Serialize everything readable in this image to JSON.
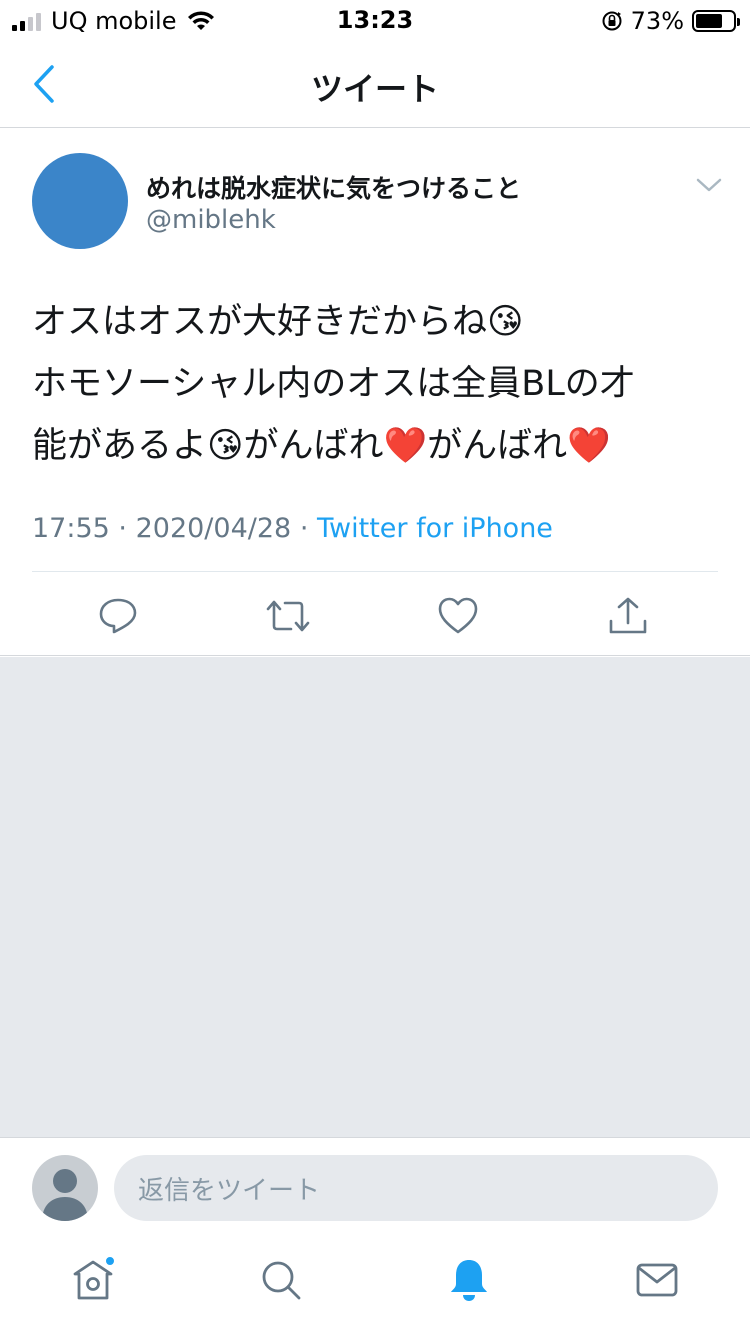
{
  "status_bar": {
    "carrier": "UQ mobile",
    "time": "13:23",
    "battery_percent": "73%",
    "battery_level": 0.73
  },
  "nav": {
    "title": "ツイート",
    "back_icon": "chevron-left-icon"
  },
  "tweet": {
    "author_name": "めれは脱水症状に気をつけること",
    "author_handle": "@miblehk",
    "text_lines": [
      "オスはオスが大好きだからね😘",
      "ホモソーシャル内のオスは全員BLの才",
      "能があるよ😘がんばれ❤️がんばれ❤️"
    ],
    "time": "17:55",
    "date": "2020/04/28",
    "separator": "·",
    "source": "Twitter for iPhone",
    "actions": [
      "reply-icon",
      "retweet-icon",
      "like-icon",
      "share-icon"
    ]
  },
  "reply": {
    "placeholder": "返信をツイート"
  },
  "tab_bar": {
    "items": [
      "home-icon",
      "search-icon",
      "notifications-icon",
      "messages-icon"
    ],
    "active": "notifications-icon"
  },
  "colors": {
    "accent": "#1da1f2",
    "text": "#14171a",
    "secondary": "#657786",
    "background_empty": "#e6e9ed",
    "avatar": "#3b85c9"
  }
}
